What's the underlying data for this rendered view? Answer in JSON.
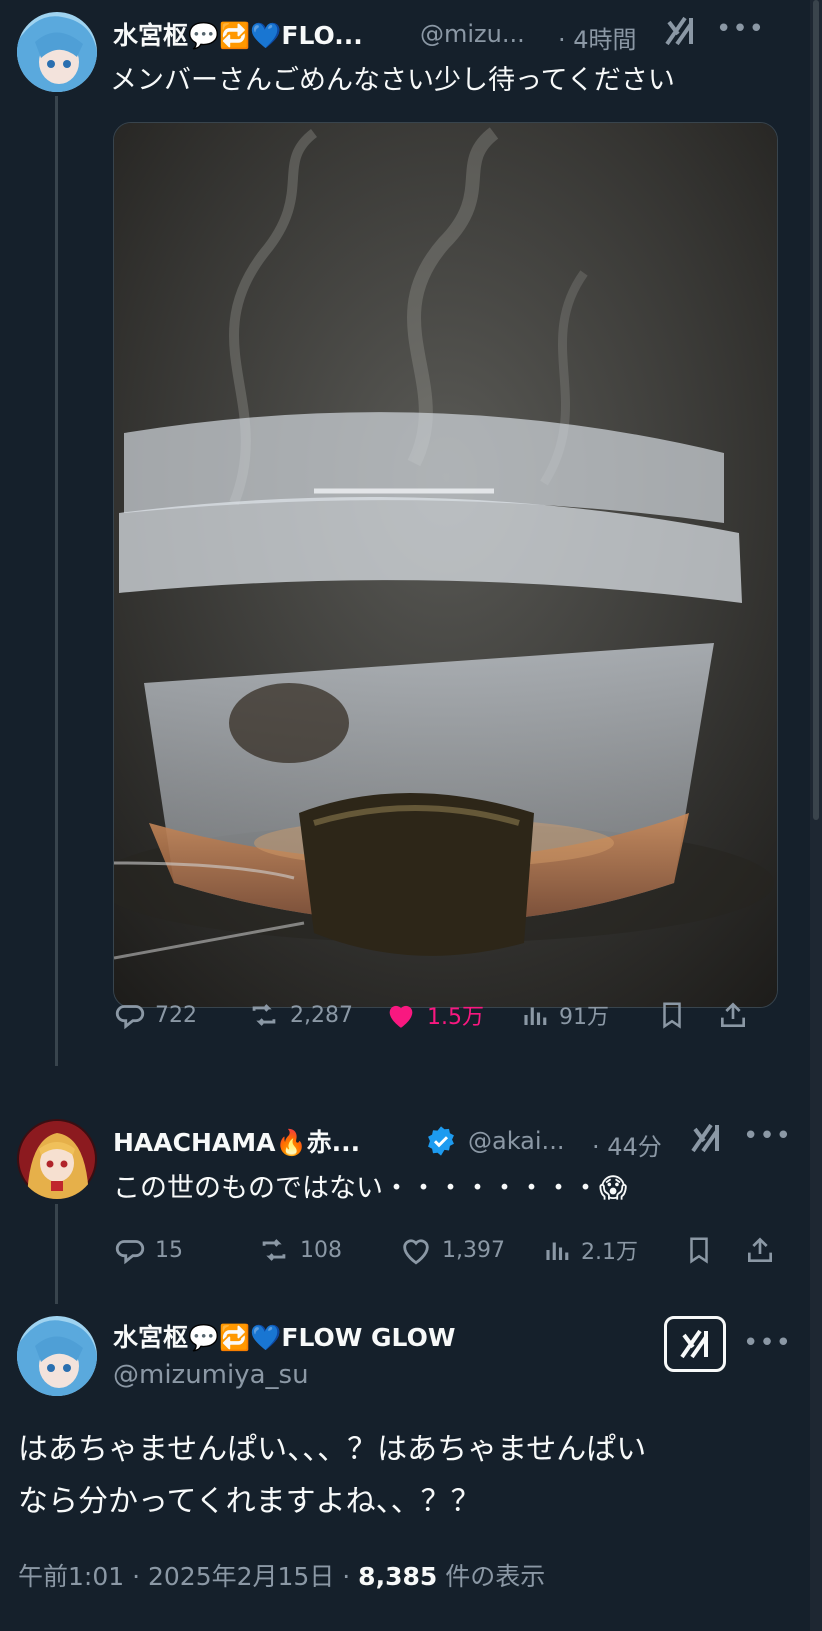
{
  "tweet1": {
    "name": "水宮枢💬🔁💙FLO...",
    "handle": "@mizu...",
    "time": "· 4時間",
    "text": "メンバーさんごめんなさい少し待ってください",
    "stats": {
      "replies": "722",
      "reposts": "2,287",
      "likes": "1.5万",
      "views": "91万"
    },
    "liked": true
  },
  "tweet2": {
    "name": "HAACHAMA🔥赤...",
    "handle": "@akai...",
    "time": "· 44分",
    "text": "この世のものではない・・・・・・・・😱",
    "verified": true,
    "stats": {
      "replies": "15",
      "reposts": "108",
      "likes": "1,397",
      "views": "2.1万"
    }
  },
  "main_tweet": {
    "name": "水宮枢💬🔁💙FLOW GLOW",
    "handle": "@mizumiya_su",
    "text_line1": "はあちゃませんぱい、、、？はあちゃませんぱい",
    "text_line2": "なら分かってくれますよね、、？？",
    "timestamp": "午前1:01 · 2025年2月15日 · ",
    "views_count": "8,385",
    "views_label": " 件の表示"
  },
  "icons": [
    "reply-icon",
    "repost-icon",
    "like-icon",
    "views-icon",
    "bookmark-icon",
    "share-icon",
    "grok-icon",
    "more-icon",
    "verified-icon"
  ],
  "colors": {
    "bg": "#15202b",
    "text": "#f7f9f9",
    "muted": "#8b98a5",
    "like": "#f91880",
    "verified": "#1d9bf0"
  }
}
